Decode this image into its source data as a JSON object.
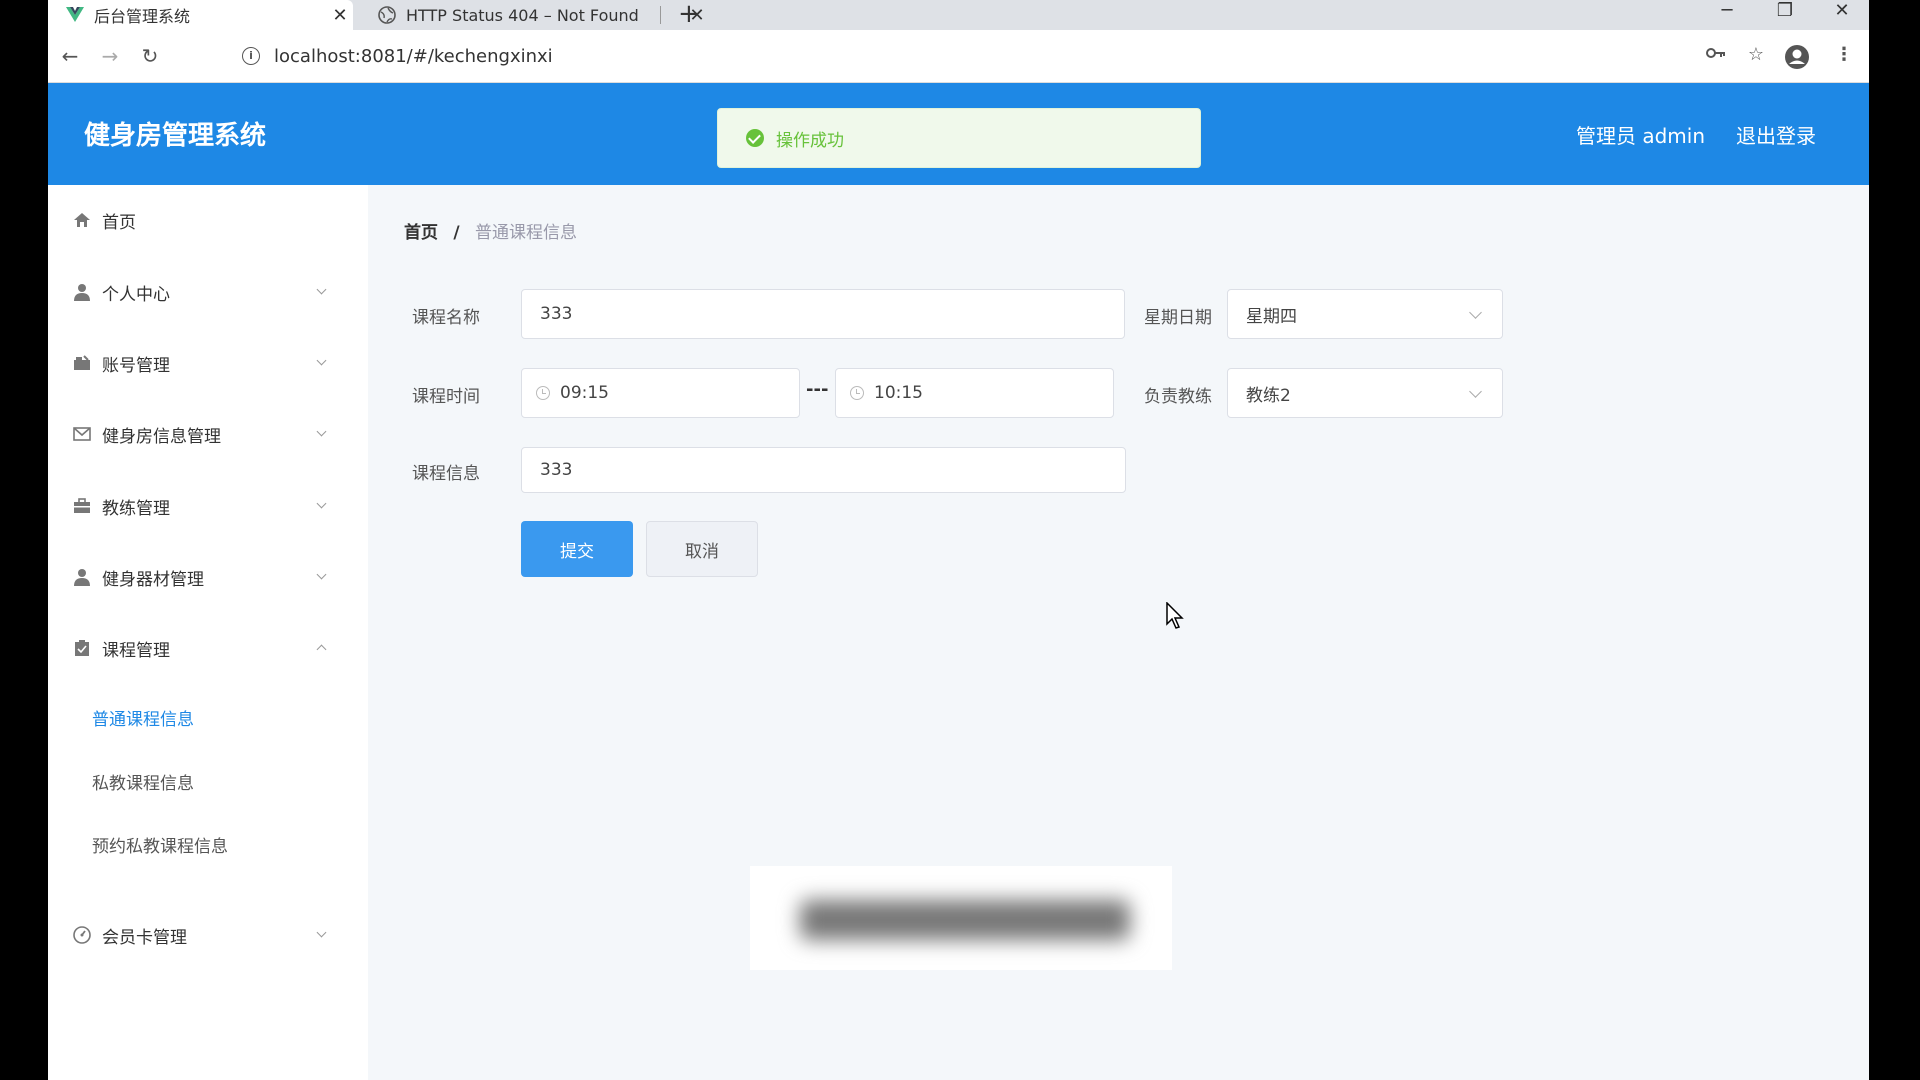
{
  "browser": {
    "tabs": [
      {
        "title": "后台管理系统",
        "active": true,
        "icon": "vue-icon"
      },
      {
        "title": "HTTP Status 404 – Not Found",
        "active": false,
        "icon": "globe-icon"
      }
    ],
    "url": "localhost:8081/#/kechengxinxi"
  },
  "header": {
    "app_title": "健身房管理系统",
    "admin_label": "管理员 admin",
    "logout_label": "退出登录",
    "accent": "#1e88e5"
  },
  "toast": {
    "message": "操作成功",
    "type": "success"
  },
  "sidebar": {
    "items": [
      {
        "label": "首页",
        "icon": "home-icon",
        "expandable": false
      },
      {
        "label": "个人中心",
        "icon": "user-icon",
        "expandable": true
      },
      {
        "label": "账号管理",
        "icon": "folder-icon",
        "expandable": true
      },
      {
        "label": "健身房信息管理",
        "icon": "mail-icon",
        "expandable": true
      },
      {
        "label": "教练管理",
        "icon": "briefcase-icon",
        "expandable": true
      },
      {
        "label": "健身器材管理",
        "icon": "user-icon",
        "expandable": true
      },
      {
        "label": "课程管理",
        "icon": "clipboard-icon",
        "expandable": true,
        "expanded": true
      },
      {
        "label": "会员卡管理",
        "icon": "gauge-icon",
        "expandable": true
      }
    ],
    "sub_items": [
      {
        "label": "普通课程信息",
        "active": true
      },
      {
        "label": "私教课程信息",
        "active": false
      },
      {
        "label": "预约私教课程信息",
        "active": false
      }
    ]
  },
  "breadcrumb": {
    "home": "首页",
    "separator": "/",
    "current": "普通课程信息"
  },
  "form": {
    "course_name_label": "课程名称",
    "course_name_value": "333",
    "weekday_label": "星期日期",
    "weekday_value": "星期四",
    "time_label": "课程时间",
    "time_start": "09:15",
    "time_sep": "---",
    "time_end": "10:15",
    "coach_label": "负责教练",
    "coach_value": "教练2",
    "info_label": "课程信息",
    "info_value": "333",
    "submit_label": "提交",
    "cancel_label": "取消"
  }
}
